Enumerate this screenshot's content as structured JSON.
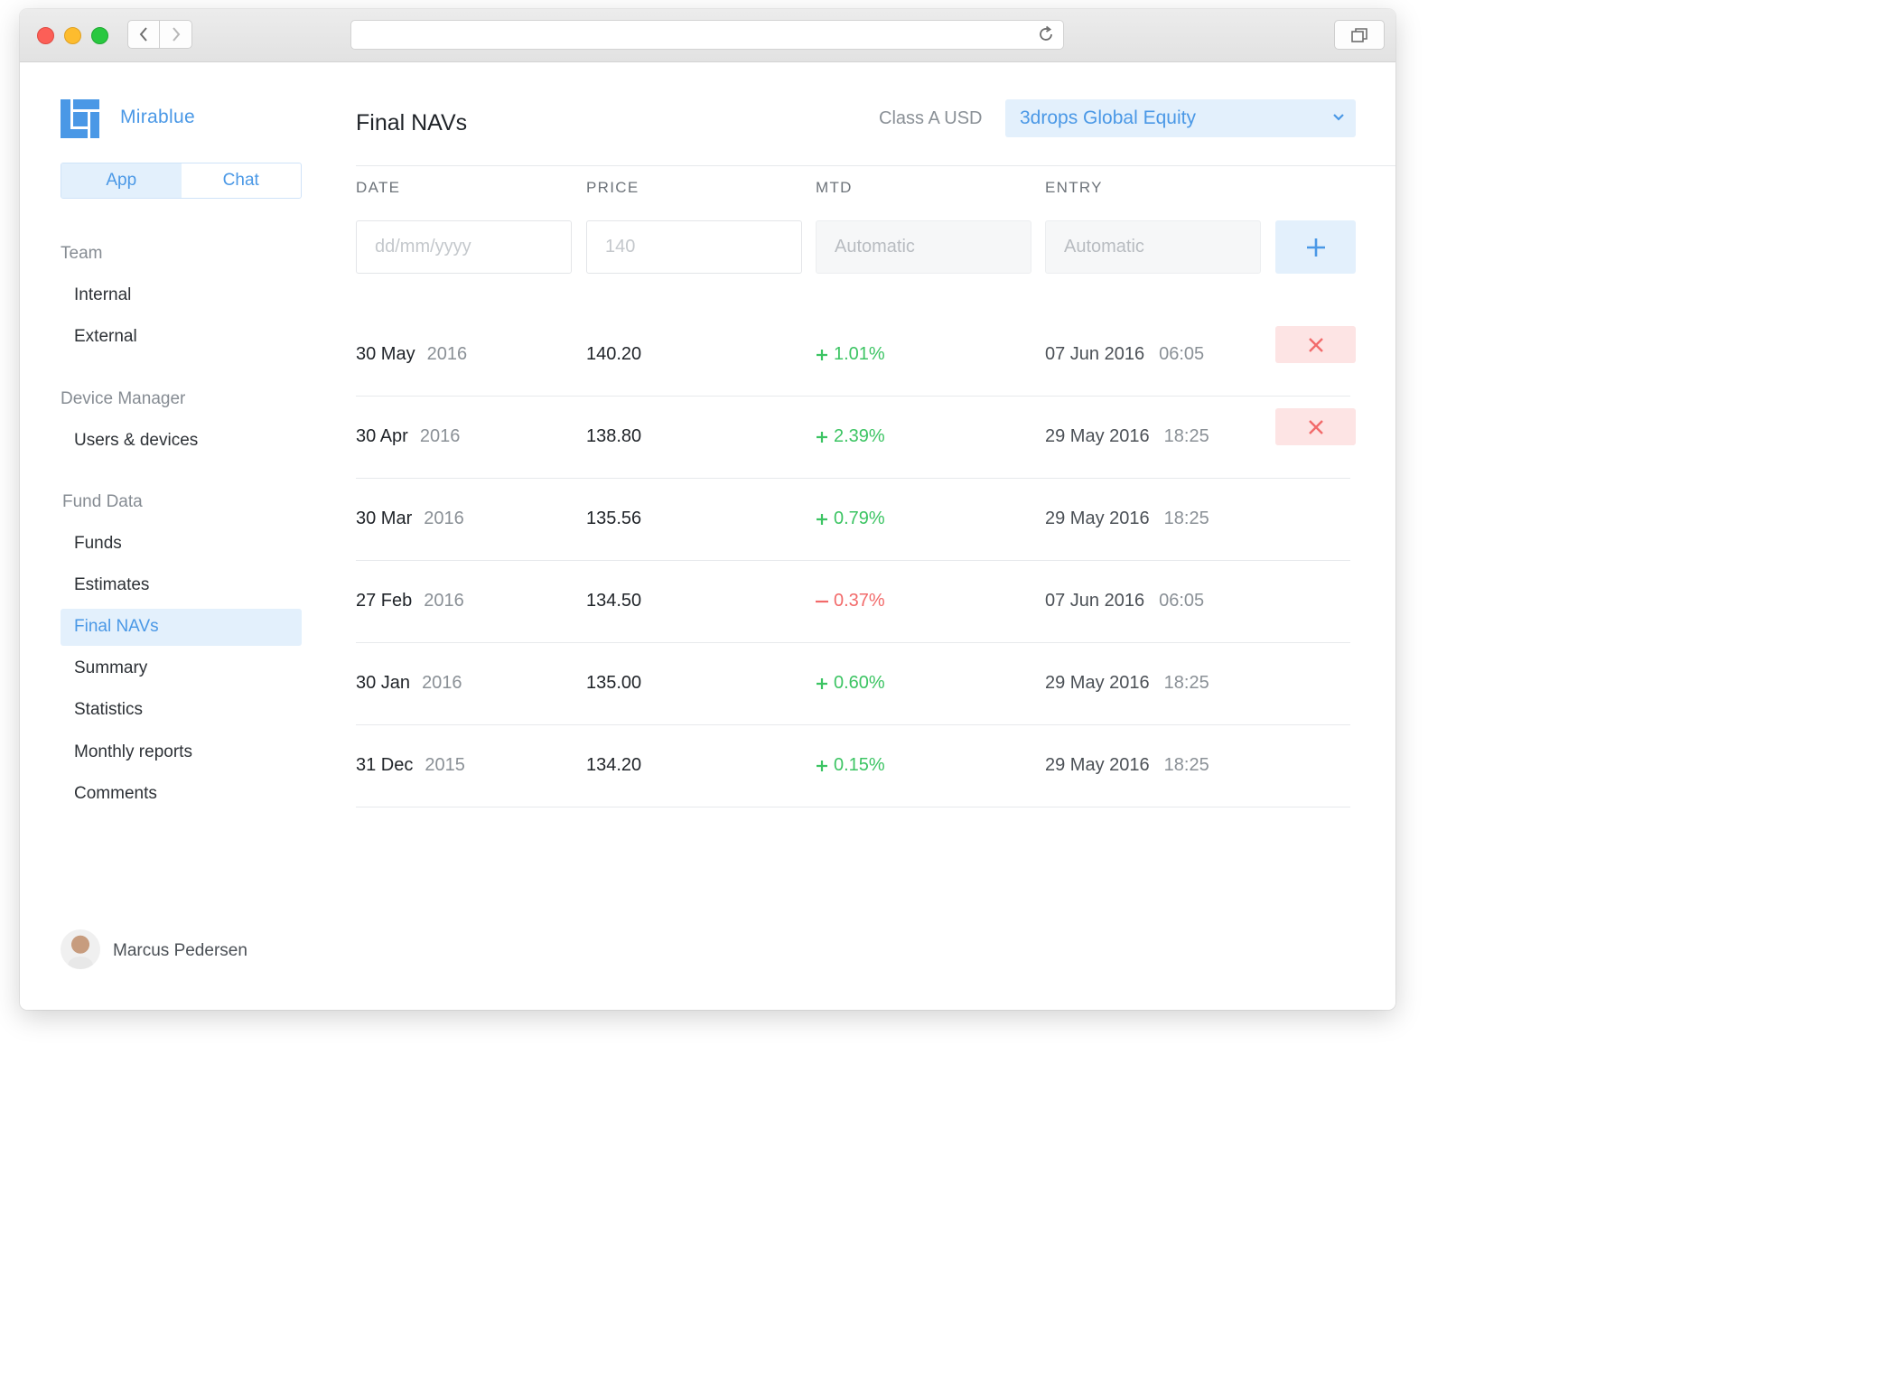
{
  "browser": {
    "url": ""
  },
  "sidebar": {
    "brand": "Mirablue",
    "segments": [
      {
        "label": "App",
        "active": true
      },
      {
        "label": "Chat",
        "active": false
      }
    ],
    "sections": [
      {
        "title": "Team",
        "items": [
          "Internal",
          "External"
        ]
      },
      {
        "title": "Device Manager",
        "items": [
          "Users & devices"
        ]
      },
      {
        "title": "Fund Data",
        "items": [
          "Funds",
          "Estimates",
          "Final NAVs",
          "Summary",
          "Statistics",
          "Monthly reports",
          "Comments"
        ]
      }
    ],
    "active_item": "Final NAVs",
    "user": {
      "name": "Marcus Pedersen"
    }
  },
  "header": {
    "title": "Final NAVs",
    "class_label": "Class A USD",
    "fund_select": {
      "value": "3drops Global Equity"
    }
  },
  "table": {
    "columns": [
      "DATE",
      "PRICE",
      "MTD",
      "ENTRY"
    ],
    "new_row": {
      "date_placeholder": "dd/mm/yyyy",
      "price_placeholder": "140",
      "mtd_placeholder": "Automatic",
      "entry_placeholder": "Automatic"
    },
    "rows": [
      {
        "date": "30 May",
        "year": "2016",
        "price": "140.20",
        "mtd": "1.01%",
        "direction": "up",
        "entry_date": "07 Jun 2016",
        "entry_time": "06:05",
        "deletable": true
      },
      {
        "date": "30 Apr",
        "year": "2016",
        "price": "138.80",
        "mtd": "2.39%",
        "direction": "up",
        "entry_date": "29 May 2016",
        "entry_time": "18:25",
        "deletable": true
      },
      {
        "date": "30 Mar",
        "year": "2016",
        "price": "135.56",
        "mtd": "0.79%",
        "direction": "up",
        "entry_date": "29 May 2016",
        "entry_time": "18:25",
        "deletable": false
      },
      {
        "date": "27 Feb",
        "year": "2016",
        "price": "134.50",
        "mtd": "0.37%",
        "direction": "down",
        "entry_date": "07 Jun 2016",
        "entry_time": "06:05",
        "deletable": false
      },
      {
        "date": "30 Jan",
        "year": "2016",
        "price": "135.00",
        "mtd": "0.60%",
        "direction": "up",
        "entry_date": "29 May 2016",
        "entry_time": "18:25",
        "deletable": false
      },
      {
        "date": "31 Dec",
        "year": "2015",
        "price": "134.20",
        "mtd": "0.15%",
        "direction": "up",
        "entry_date": "29 May 2016",
        "entry_time": "18:25",
        "deletable": false
      }
    ]
  },
  "colors": {
    "accent": "#4a98e6",
    "accent_bg": "#e3f0fc",
    "positive": "#3cc463",
    "negative": "#f26a6a",
    "danger_bg": "#fde4e4"
  }
}
